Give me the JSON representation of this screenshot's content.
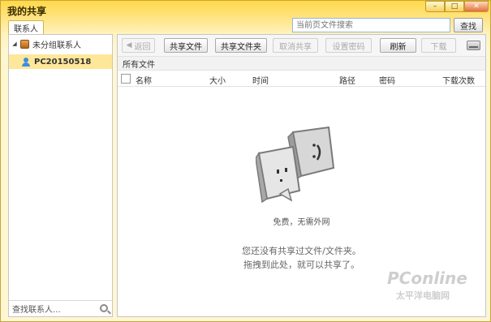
{
  "window": {
    "title": "我的共享",
    "controls": {
      "minimize": "–",
      "maximize": "□",
      "close": "✕"
    }
  },
  "search": {
    "placeholder": "当前页文件搜索",
    "button_label": "查找"
  },
  "sidebar": {
    "tab_label": "联系人",
    "group": {
      "label": "未分组联系人",
      "expanded": true
    },
    "contacts": [
      {
        "label": "PC20150518",
        "selected": true
      }
    ],
    "search_placeholder": "查找联系人..."
  },
  "toolbar": {
    "back": "返回",
    "share_file": "共享文件",
    "share_folder": "共享文件夹",
    "cancel_share": "取消共享",
    "set_password": "设置密码",
    "refresh": "刷新",
    "download": "下载",
    "drive_icon": "drive-icon"
  },
  "breadcrumb": "所有文件",
  "table": {
    "columns": [
      "名称",
      "大小",
      "时间",
      "路径",
      "密码",
      "下载次数"
    ]
  },
  "empty_state": {
    "title": "免费，无需外网",
    "line1": "您还没有共享过文件/文件夹。",
    "line2": "拖拽到此处，就可以共享了。"
  },
  "watermark": {
    "brand": "PConline",
    "sub": "太平洋电脑网"
  },
  "colors": {
    "title_bar": "#ffd94a",
    "selected_row": "#ffe79a",
    "accent_blue": "#3a8fe0"
  }
}
